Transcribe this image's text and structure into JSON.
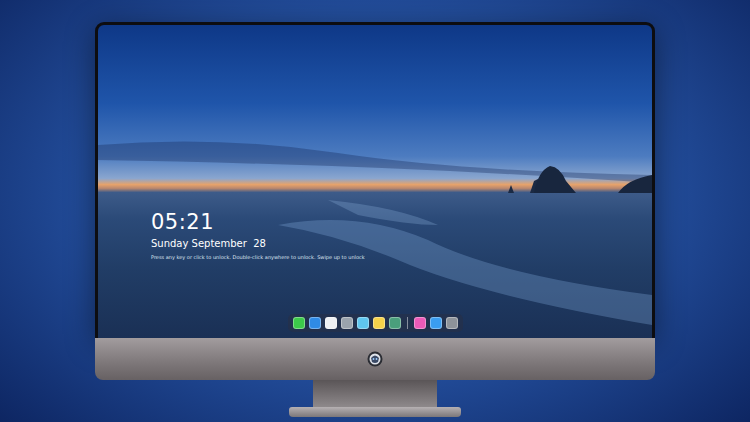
{
  "lock_screen": {
    "time": "05:21",
    "date": "Sunday September  28",
    "hint": "Press any key or click to unlock. Double-click anywhere to unlock. Swipe up to unlock"
  },
  "dock": {
    "groups": [
      [
        {
          "color": "#3cc94a"
        },
        {
          "color": "#2f8be6"
        },
        {
          "color": "#eef0f3"
        },
        {
          "color": "#9aa3ad"
        },
        {
          "color": "#5fc6ef"
        },
        {
          "color": "#f6d24a"
        },
        {
          "color": "#4a9f7c"
        }
      ],
      [
        {
          "color": "#ec5ab8"
        },
        {
          "color": "#3a9df0"
        },
        {
          "color": "#8e939a"
        }
      ]
    ]
  }
}
